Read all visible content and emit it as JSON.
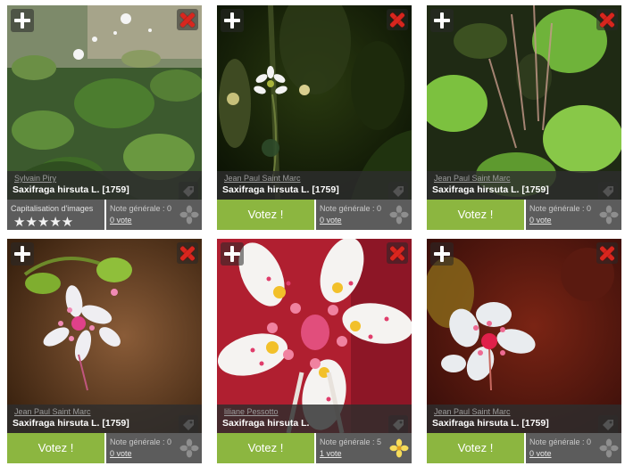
{
  "cards": [
    {
      "author": "Sylvain Piry",
      "species": "Saxifraga hirsuta L. [1759]",
      "capital_label": "Capitalisation d'images",
      "stars": "★★★★★",
      "score_label": "Note générale : 0",
      "votes": "0 vote",
      "flower_color": "#8e8e8e"
    },
    {
      "author": "Jean Paul Saint Marc",
      "species": "Saxifraga hirsuta L. [1759]",
      "vote_label": "Votez !",
      "score_label": "Note générale : 0",
      "votes": "0 vote",
      "flower_color": "#8e8e8e"
    },
    {
      "author": "Jean Paul Saint Marc",
      "species": "Saxifraga hirsuta L. [1759]",
      "vote_label": "Votez !",
      "score_label": "Note générale : 0",
      "votes": "0 vote",
      "flower_color": "#8e8e8e"
    },
    {
      "author": "Jean Paul Saint Marc",
      "species": "Saxifraga hirsuta L. [1759]",
      "vote_label": "Votez !",
      "score_label": "Note générale : 0",
      "votes": "0 vote",
      "flower_color": "#8e8e8e"
    },
    {
      "author": "liliane Pessotto",
      "species": "Saxifraga hirsuta L.",
      "vote_label": "Votez !",
      "score_label": "Note générale : 5",
      "votes": "1 vote",
      "flower_color": "#f7dc5a"
    },
    {
      "author": "Jean Paul Saint Marc",
      "species": "Saxifraga hirsuta L. [1759]",
      "vote_label": "Votez !",
      "score_label": "Note générale : 0",
      "votes": "0 vote",
      "flower_color": "#8e8e8e"
    }
  ],
  "colors": {
    "vote_green": "#8cb640",
    "panel_grey": "#5c5c5c",
    "close_red": "#d8261e"
  }
}
